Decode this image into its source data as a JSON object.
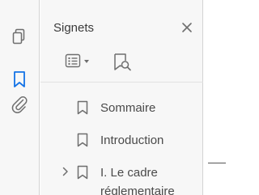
{
  "colors": {
    "accent": "#1473e6",
    "icon_gray": "#6e6e6e",
    "text": "#4a4a4a",
    "panel_bg": "#f7f7f7"
  },
  "toolrail": {
    "icons": [
      "page-thumbnails-icon",
      "bookmark-icon",
      "attachment-icon"
    ],
    "active": "bookmark-icon"
  },
  "panel": {
    "title": "Signets",
    "close_icon": "close-icon",
    "toolbar": {
      "options_icon": "list-options-icon",
      "new_bookmark_icon": "new-bookmark-icon"
    }
  },
  "bookmarks": [
    {
      "label": "Sommaire",
      "expandable": false
    },
    {
      "label": "Introduction",
      "expandable": false
    },
    {
      "label": "I. Le cadre\nréglementaire",
      "expandable": true
    }
  ]
}
